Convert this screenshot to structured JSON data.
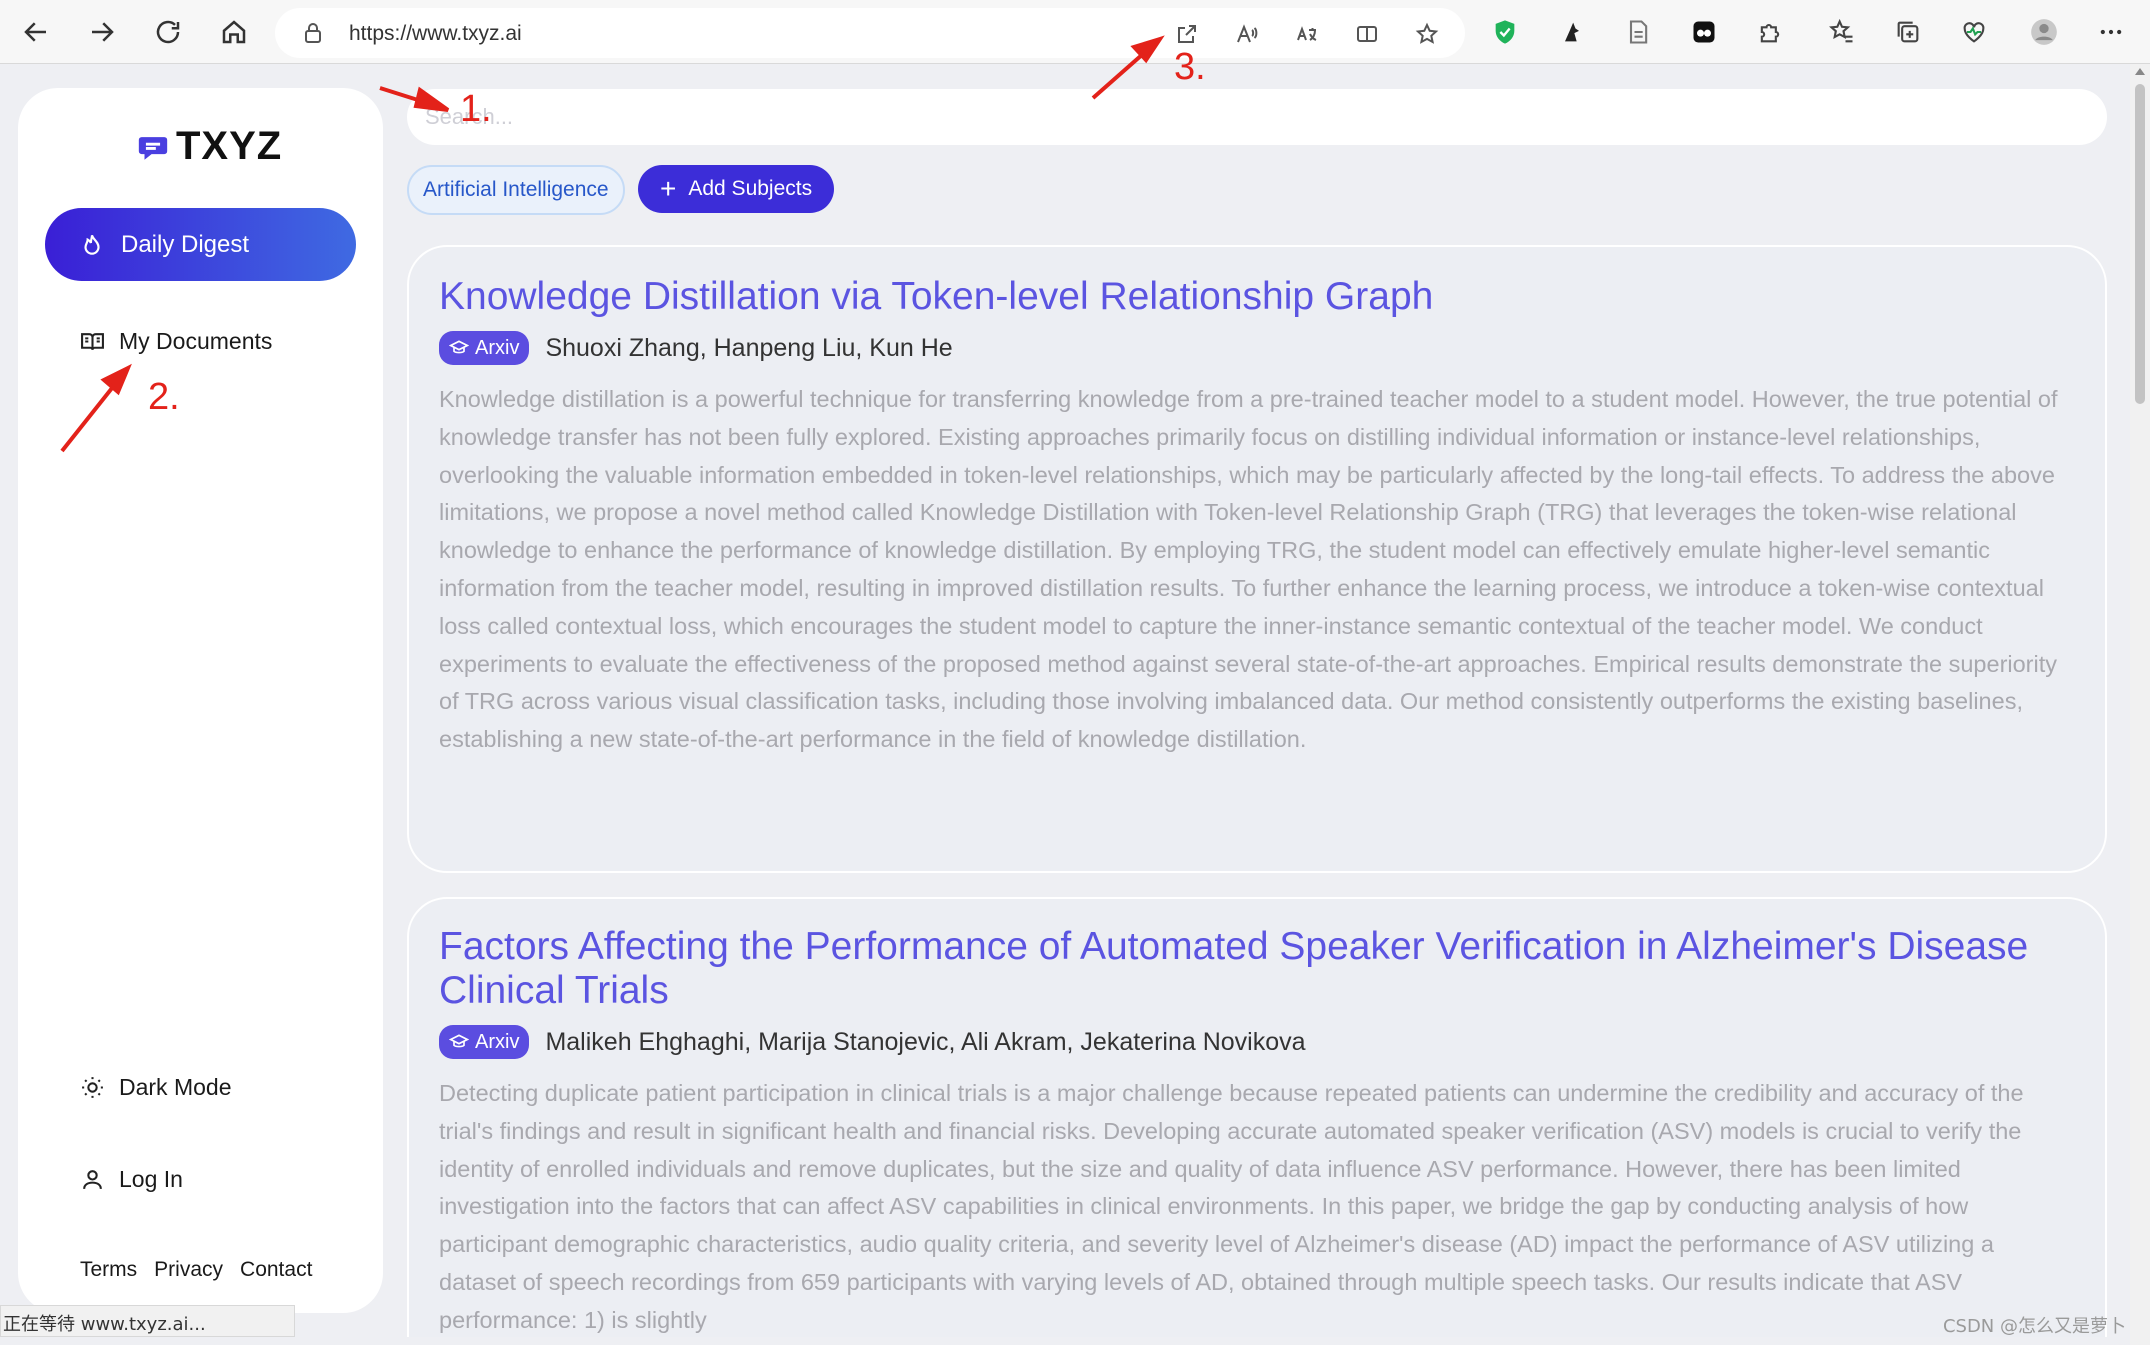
{
  "browser": {
    "url": "https://www.txyz.ai",
    "status_text": "正在等待 www.txyz.ai...",
    "watermark": "CSDN @怎么又是萝卜"
  },
  "sidebar": {
    "logo_text": "TXYZ",
    "digest_label": "Daily Digest",
    "documents_label": "My Documents",
    "dark_mode_label": "Dark Mode",
    "login_label": "Log In",
    "footer": {
      "terms": "Terms",
      "privacy": "Privacy",
      "contact": "Contact"
    }
  },
  "search": {
    "placeholder": "Search..."
  },
  "subjects": {
    "selected": "Artificial Intelligence",
    "add_label": "Add Subjects"
  },
  "papers": [
    {
      "title": "Knowledge Distillation via Token-level Relationship Graph",
      "source": "Arxiv",
      "authors": "Shuoxi Zhang, Hanpeng Liu, Kun He",
      "abstract": "Knowledge distillation is a powerful technique for transferring knowledge from a pre-trained teacher model to a student model. However, the true potential of knowledge transfer has not been fully explored. Existing approaches primarily focus on distilling individual information or instance-level relationships, overlooking the valuable information embedded in token-level relationships, which may be particularly affected by the long-tail effects. To address the above limitations, we propose a novel method called Knowledge Distillation with Token-level Relationship Graph (TRG) that leverages the token-wise relational knowledge to enhance the performance of knowledge distillation. By employing TRG, the student model can effectively emulate higher-level semantic information from the teacher model, resulting in improved distillation results. To further enhance the learning process, we introduce a token-wise contextual loss called contextual loss, which encourages the student model to capture the inner-instance semantic contextual of the teacher model. We conduct experiments to evaluate the effectiveness of the proposed method against several state-of-the-art approaches. Empirical results demonstrate the superiority of TRG across various visual classification tasks, including those involving imbalanced data. Our method consistently outperforms the existing baselines, establishing a new state-of-the-art performance in the field of knowledge distillation."
    },
    {
      "title": "Factors Affecting the Performance of Automated Speaker Verification in Alzheimer's Disease Clinical Trials",
      "source": "Arxiv",
      "authors": "Malikeh Ehghaghi, Marija Stanojevic, Ali Akram, Jekaterina Novikova",
      "abstract": "Detecting duplicate patient participation in clinical trials is a major challenge because repeated patients can undermine the credibility and accuracy of the trial's findings and result in significant health and financial risks. Developing accurate automated speaker verification (ASV) models is crucial to verify the identity of enrolled individuals and remove duplicates, but the size and quality of data influence ASV performance. However, there has been limited investigation into the factors that can affect ASV capabilities in clinical environments. In this paper, we bridge the gap by conducting analysis of how participant demographic characteristics, audio quality criteria, and severity level of Alzheimer's disease (AD) impact the performance of ASV utilizing a dataset of speech recordings from 659 participants with varying levels of AD, obtained through multiple speech tasks. Our results indicate that ASV performance: 1) is slightly"
    }
  ],
  "annotations": {
    "a1": "1.",
    "a2": "2.",
    "a3": "3."
  },
  "colors": {
    "accent": "#3c2dd8",
    "title": "#5b54e1",
    "annotation": "#e3221a"
  }
}
